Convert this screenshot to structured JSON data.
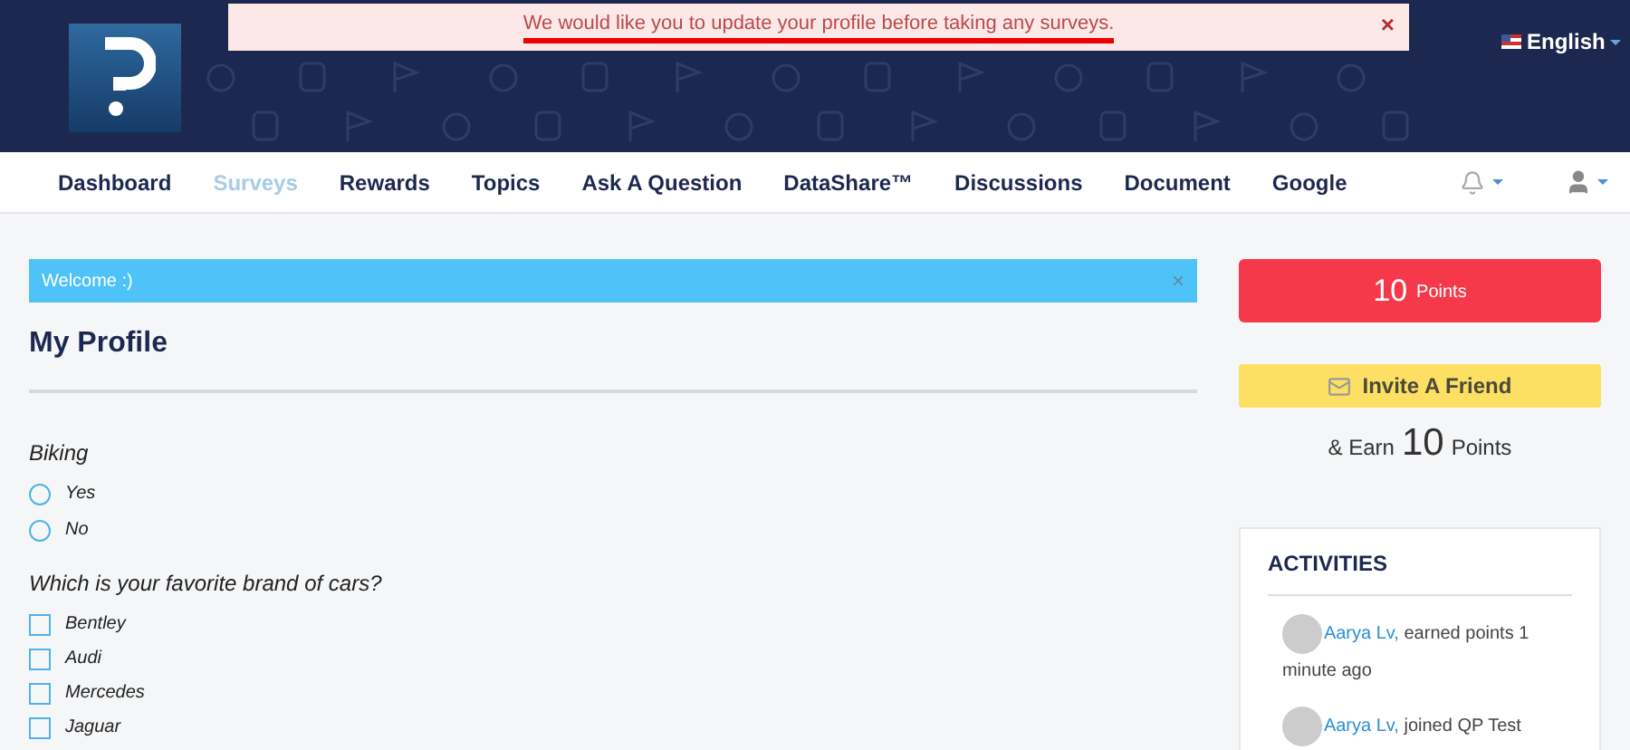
{
  "alert": {
    "message": "We would like you to update your profile before taking any surveys.",
    "close": "×"
  },
  "language": {
    "label": "English"
  },
  "nav": [
    {
      "label": "Dashboard",
      "selected": false
    },
    {
      "label": "Surveys",
      "selected": true
    },
    {
      "label": "Rewards",
      "selected": false
    },
    {
      "label": "Topics",
      "selected": false
    },
    {
      "label": "Ask A Question",
      "selected": false
    },
    {
      "label": "DataShare™",
      "selected": false
    },
    {
      "label": "Discussions",
      "selected": false
    },
    {
      "label": "Document",
      "selected": false
    },
    {
      "label": "Google",
      "selected": false
    }
  ],
  "welcome": {
    "message": "Welcome :)",
    "close": "×"
  },
  "profile": {
    "title": "My Profile",
    "questions": [
      {
        "kind": "radio",
        "question": "Biking",
        "options": [
          {
            "label": "Yes",
            "checked": false
          },
          {
            "label": "No",
            "checked": false
          }
        ]
      },
      {
        "kind": "checkbox",
        "question": "Which is your favorite brand of cars?",
        "options": [
          {
            "label": "Bentley",
            "checked": false
          },
          {
            "label": "Audi",
            "checked": false
          },
          {
            "label": "Mercedes",
            "checked": false
          },
          {
            "label": "Jaguar",
            "checked": false
          }
        ]
      }
    ]
  },
  "points": {
    "value": "10",
    "unit": "Points"
  },
  "invite": {
    "button": "Invite A Friend",
    "prefix": "& Earn",
    "value": "10",
    "unit": "Points"
  },
  "activities": {
    "title": "ACTIVITIES",
    "items": [
      {
        "user": "Aarya Lv,",
        "text": "earned points  1 minute ago"
      },
      {
        "user": "Aarya Lv,",
        "text": "joined QP Test"
      }
    ]
  }
}
